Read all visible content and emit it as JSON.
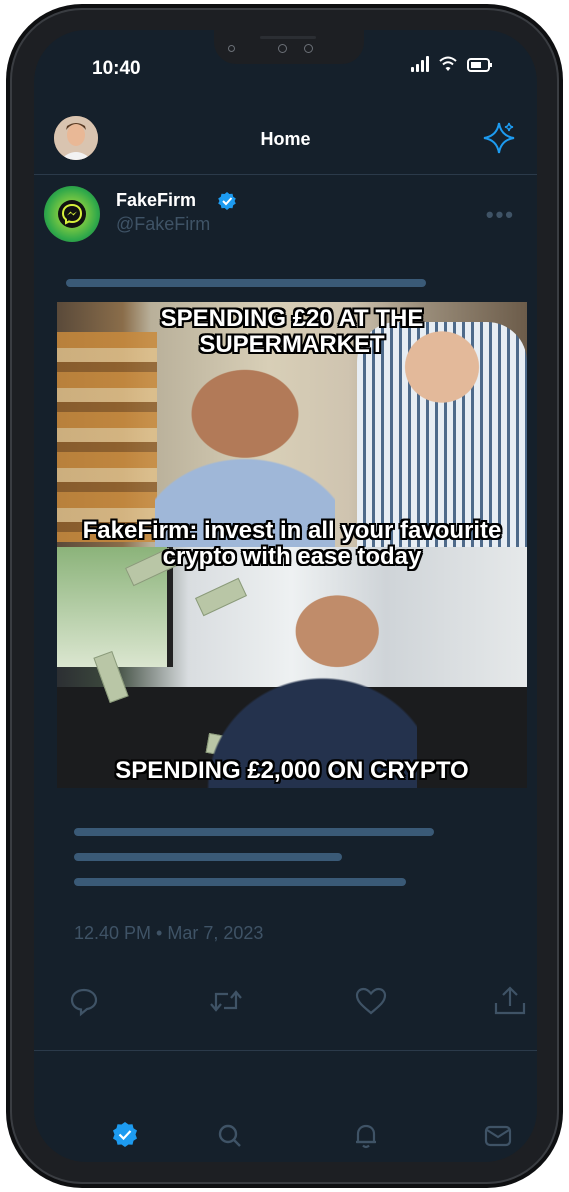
{
  "status_bar": {
    "time": "10:40"
  },
  "header": {
    "title": "Home"
  },
  "tweet": {
    "name": "FakeFirm",
    "handle": "@FakeFirm",
    "more_label": "•••",
    "meme": {
      "top_text": "SPENDING £20 AT THE SUPERMARKET",
      "middle_text": "FakeFirm: invest in all your favourite crypto with ease today",
      "bottom_text": "SPENDING £2,000 ON CRYPTO"
    },
    "timestamp": "12.40 PM • Mar 7, 2023"
  },
  "actions": [
    "reply-icon",
    "retweet-icon",
    "like-icon",
    "share-icon"
  ],
  "tabs": [
    "home-icon",
    "search-icon",
    "notifications-icon",
    "messages-icon"
  ],
  "colors": {
    "background": "#15202b",
    "accent": "#1d9bf0",
    "muted": "#3f5366",
    "placeholder_bar": "#3a5a77"
  }
}
